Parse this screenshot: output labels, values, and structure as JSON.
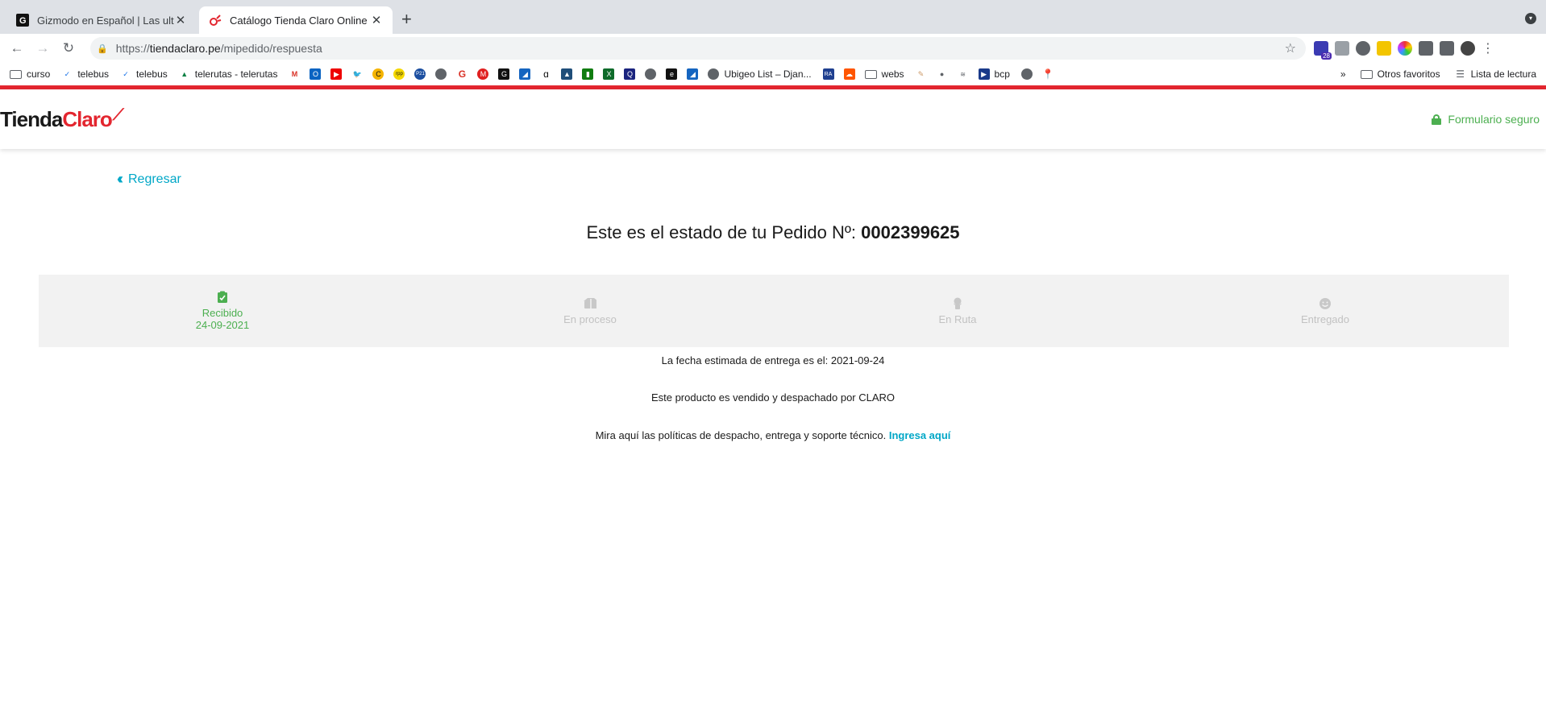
{
  "browser": {
    "tabs": [
      {
        "title": "Gizmodo en Español | Las ultim",
        "active": false,
        "icon": "gizmodo-icon"
      },
      {
        "title": "Catálogo Tienda Claro Online |",
        "active": true,
        "icon": "claro-icon"
      }
    ],
    "url_scheme": "https://",
    "url_host": "tiendaclaro.pe",
    "url_path": "/mipedido/respuesta",
    "extension_badge": "28",
    "bookmarks": [
      {
        "label": "curso",
        "icon": "folder-icon"
      },
      {
        "label": "telebus",
        "icon": "check-icon"
      },
      {
        "label": "telebus",
        "icon": "check-icon"
      },
      {
        "label": "telerutas - telerutas",
        "icon": "telerutas-icon"
      },
      {
        "label": "Ubigeo List – Djan...",
        "icon": "globe-icon"
      },
      {
        "label": "webs",
        "icon": "folder-icon"
      },
      {
        "label": "bcp",
        "icon": "bcp-icon"
      }
    ],
    "bookmarks_overflow": "»",
    "other_bookmarks": "Otros favoritos",
    "reading_list": "Lista de lectura"
  },
  "site": {
    "logo_part1": "Tienda",
    "logo_part2": "Claro",
    "secure_label": "Formulario seguro",
    "back_label": "Regresar",
    "order_title_prefix": "Este es el estado de tu Pedido Nº:",
    "order_number": "0002399625",
    "steps": [
      {
        "label": "Recibido",
        "date": "24-09-2021",
        "done": true,
        "icon": "clipboard-check-icon"
      },
      {
        "label": "En proceso",
        "date": "",
        "done": false,
        "icon": "box-icon"
      },
      {
        "label": "En Ruta",
        "date": "",
        "done": false,
        "icon": "truck-icon"
      },
      {
        "label": "Entregado",
        "date": "",
        "done": false,
        "icon": "smile-icon"
      }
    ],
    "delivery_estimate": "La fecha estimada de entrega es el: 2021-09-24",
    "seller_note": "Este producto es vendido y despachado por CLARO",
    "policy_text": "Mira aquí las políticas de despacho, entrega y soporte técnico.",
    "policy_link": "Ingresa aquí"
  },
  "colors": {
    "brand_red": "#e3262f",
    "accent_cyan": "#00a7c7",
    "success_green": "#4caf50",
    "inactive_gray": "#c2c2c2"
  }
}
